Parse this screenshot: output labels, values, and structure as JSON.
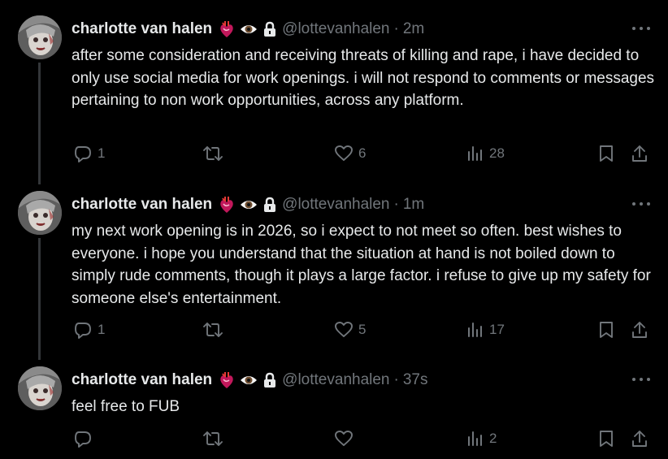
{
  "tweets": [
    {
      "name": "charlotte van halen",
      "handle": "@lottevanhalen",
      "time": "2m",
      "text": "after some consideration and receiving threats of killing and rape, i have decided to only use social media for work openings. i will not respond to comments or messages pertaining to non work opportunities, across any platform.",
      "replies": "1",
      "retweets": "",
      "likes": "6",
      "views": "28"
    },
    {
      "name": "charlotte van halen",
      "handle": "@lottevanhalen",
      "time": "1m",
      "text": "my next work opening is in 2026, so i expect to not meet so often. best wishes to everyone. i hope you understand that the situation at hand is not boiled down to simply rude comments, though it plays a large factor. i refuse to give up my safety for someone else's entertainment.",
      "replies": "1",
      "retweets": "",
      "likes": "5",
      "views": "17"
    },
    {
      "name": "charlotte van halen",
      "handle": "@lottevanhalen",
      "time": "37s",
      "text": "feel free to FUB",
      "replies": "",
      "retweets": "",
      "likes": "",
      "views": "2"
    }
  ],
  "name_badges": [
    "anatomical-heart-icon",
    "eye-icon",
    "lock-icon"
  ],
  "colors": {
    "background": "#000000",
    "primary_text": "#e7e9ea",
    "secondary_text": "#71767b",
    "thread_line": "#333639"
  }
}
